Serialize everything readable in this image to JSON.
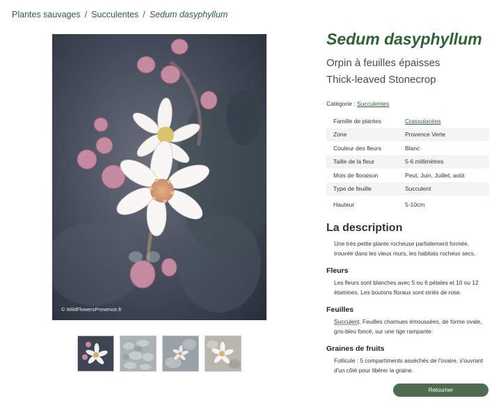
{
  "breadcrumb": {
    "items": [
      "Plantes sauvages",
      "Succulentes"
    ],
    "separator": "/",
    "current": "Sedum dasyphyllum"
  },
  "photo": {
    "credit": "© WildFlowersProvence.fr"
  },
  "thumbnails": [
    "thumb-flower-close",
    "thumb-leaves",
    "thumb-plant",
    "thumb-flower-pale"
  ],
  "plant": {
    "scientific_name": "Sedum dasyphyllum",
    "common_fr": "Orpin à feuilles épaisses",
    "common_en": "Thick-leaved Stonecrop",
    "category_label": "Catégorie :",
    "category_value": "Succulentes"
  },
  "properties": [
    {
      "key": "Famille de plantes",
      "value": "Crassulacées",
      "link": true
    },
    {
      "key": "Zone",
      "value": "Provence Verte"
    },
    {
      "key": "Couleur des fleurs",
      "value": "Blanc"
    },
    {
      "key": "Taille de la fleur",
      "value": "5-6 millimètres"
    },
    {
      "key": "Mois de floraison",
      "value": "Peut, Juin, Juillet, août"
    },
    {
      "key": "Type de feuille",
      "value": "Succulent"
    },
    {
      "key": "Hauteur",
      "value": "5-10cm"
    }
  ],
  "description": {
    "title": "La description",
    "text": "Une très petite plante rocheuse parfaitement formée, trouvée dans les vieux murs, les habitats rocheux secs.",
    "flowers_title": "Fleurs",
    "flowers_text": "Les fleurs sont blanches avec 5 ou 6 pétales et 10 ou 12 étamines. Les boutons floraux sont striés de rose.",
    "leaves_title": "Feuilles",
    "leaves_term": "Succulent",
    "leaves_text": ". Feuilles charnues émoussées, de forme ovale, gris-bleu foncé, sur une tige rampante.",
    "fruits_title": "Graines de fruits",
    "fruits_text": "Follicule : 5 compartiments asséchés de l'ovaire, s'ouvrant d'un côté pour libérer la graine."
  },
  "back_button": "Retourner",
  "colors": {
    "accent": "#2e5f36",
    "button": "#4f6b50"
  }
}
